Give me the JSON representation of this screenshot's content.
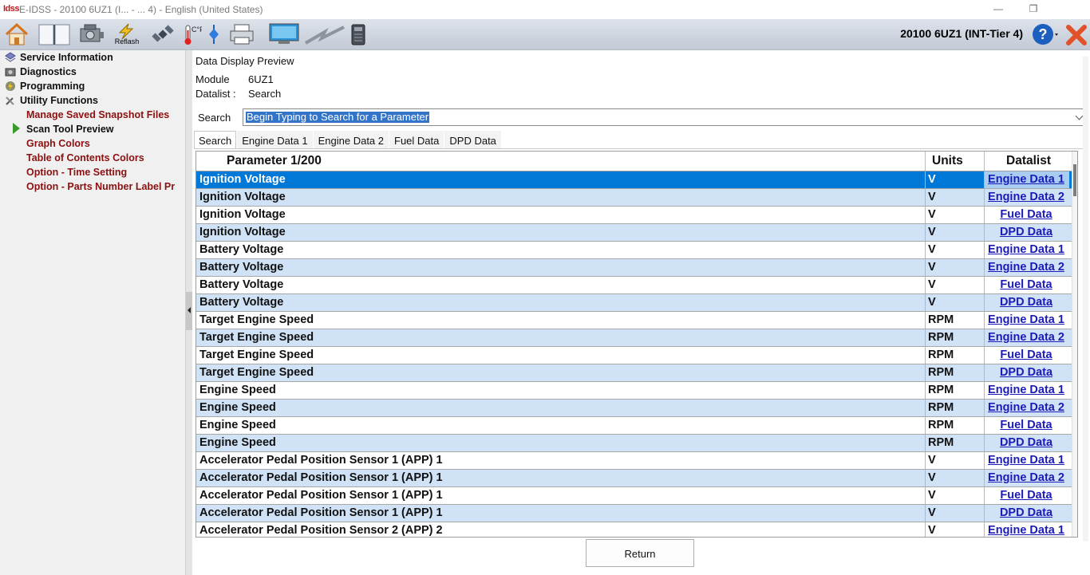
{
  "window": {
    "logo": "Idss",
    "title": "E-IDSS - 20100 6UZ1 (I... - ... 4) - English (United States)",
    "minimize": "—",
    "restore": "❐"
  },
  "toolbar": {
    "home_icon": "home-icon",
    "book_icon": "book-icon",
    "engine_icon": "engine-icon",
    "reflash_label": "Reflash",
    "vehicle_id": "20100 6UZ1 (INT-Tier 4)"
  },
  "sidebar": {
    "sections": [
      {
        "label": "Service Information",
        "icon": "book-icon"
      },
      {
        "label": "Diagnostics",
        "icon": "engine-icon"
      },
      {
        "label": "Programming",
        "icon": "lightning-icon"
      },
      {
        "label": "Utility Functions",
        "icon": "tools-icon"
      }
    ],
    "utility_items": [
      {
        "label": "Manage Saved Snapshot Files",
        "active": false
      },
      {
        "label": "Scan Tool Preview",
        "active": true
      },
      {
        "label": "Graph Colors",
        "active": false
      },
      {
        "label": "Table of Contents Colors",
        "active": false
      },
      {
        "label": "Option - Time Setting",
        "active": false
      },
      {
        "label": "Option - Parts Number Label Pr",
        "active": false
      }
    ]
  },
  "main": {
    "title": "Data Display Preview",
    "module_label": "Module",
    "module_value": "6UZ1",
    "datalist_label": "Datalist :",
    "datalist_value": "Search",
    "search_label": "Search",
    "search_value": "Begin Typing to Search for a Parameter",
    "tabs": [
      "Search",
      "Engine Data 1",
      "Engine Data 2",
      "Fuel Data",
      "DPD Data"
    ],
    "active_tab": 0,
    "table": {
      "headers": {
        "parameter": "Parameter 1/200",
        "units": "Units",
        "datalist": "Datalist"
      },
      "rows": [
        {
          "parameter": "Ignition Voltage",
          "units": "V",
          "datalist": "Engine Data 1"
        },
        {
          "parameter": "Ignition Voltage",
          "units": "V",
          "datalist": "Engine Data 2"
        },
        {
          "parameter": "Ignition Voltage",
          "units": "V",
          "datalist": "Fuel Data"
        },
        {
          "parameter": "Ignition Voltage",
          "units": "V",
          "datalist": "DPD Data"
        },
        {
          "parameter": "Battery Voltage",
          "units": "V",
          "datalist": "Engine Data 1"
        },
        {
          "parameter": "Battery Voltage",
          "units": "V",
          "datalist": "Engine Data 2"
        },
        {
          "parameter": "Battery Voltage",
          "units": "V",
          "datalist": "Fuel Data"
        },
        {
          "parameter": "Battery Voltage",
          "units": "V",
          "datalist": "DPD Data"
        },
        {
          "parameter": "Target Engine Speed",
          "units": "RPM",
          "datalist": "Engine Data 1"
        },
        {
          "parameter": "Target Engine Speed",
          "units": "RPM",
          "datalist": "Engine Data 2"
        },
        {
          "parameter": "Target Engine Speed",
          "units": "RPM",
          "datalist": "Fuel Data"
        },
        {
          "parameter": "Target Engine Speed",
          "units": "RPM",
          "datalist": "DPD Data"
        },
        {
          "parameter": "Engine Speed",
          "units": "RPM",
          "datalist": "Engine Data 1"
        },
        {
          "parameter": "Engine Speed",
          "units": "RPM",
          "datalist": "Engine Data 2"
        },
        {
          "parameter": "Engine Speed",
          "units": "RPM",
          "datalist": "Fuel Data"
        },
        {
          "parameter": "Engine Speed",
          "units": "RPM",
          "datalist": "DPD Data"
        },
        {
          "parameter": "Accelerator Pedal Position Sensor 1 (APP) 1",
          "units": "V",
          "datalist": "Engine Data 1"
        },
        {
          "parameter": "Accelerator Pedal Position Sensor 1 (APP) 1",
          "units": "V",
          "datalist": "Engine Data 2"
        },
        {
          "parameter": "Accelerator Pedal Position Sensor 1 (APP) 1",
          "units": "V",
          "datalist": "Fuel Data"
        },
        {
          "parameter": "Accelerator Pedal Position Sensor 1 (APP) 1",
          "units": "V",
          "datalist": "DPD Data"
        },
        {
          "parameter": "Accelerator Pedal Position Sensor 2 (APP) 2",
          "units": "V",
          "datalist": "Engine Data 1"
        }
      ],
      "selected_row": 0
    },
    "return_label": "Return"
  },
  "colors": {
    "selection": "#0078d7",
    "alt_row": "#cfe2f6",
    "link": "#1b1bb8",
    "sidebar_item": "#8b1010"
  }
}
